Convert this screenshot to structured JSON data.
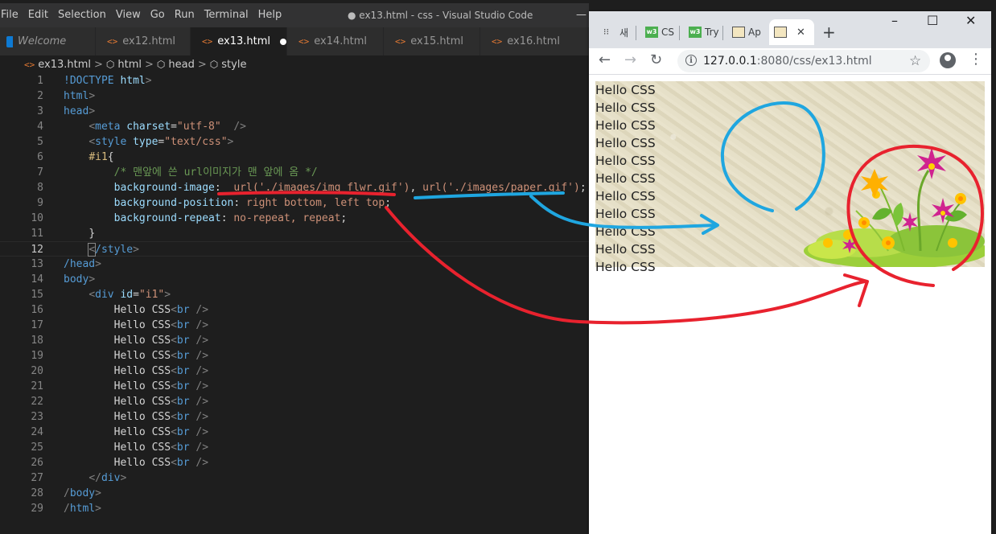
{
  "vscode": {
    "menu": [
      "File",
      "Edit",
      "Selection",
      "View",
      "Go",
      "Run",
      "Terminal",
      "Help"
    ],
    "window_title": "● ex13.html - css - Visual Studio Code",
    "tabs": [
      {
        "label": "Welcome",
        "active": false
      },
      {
        "label": "ex12.html",
        "active": false
      },
      {
        "label": "ex13.html",
        "active": true,
        "modified": true
      },
      {
        "label": "ex14.html",
        "active": false
      },
      {
        "label": "ex15.html",
        "active": false
      },
      {
        "label": "ex16.html",
        "active": false
      }
    ],
    "breadcrumb": [
      "ex13.html",
      "html",
      "head",
      "style"
    ],
    "code": [
      {
        "n": "1",
        "tokens": [
          [
            "tag",
            "!DOCTYPE "
          ],
          [
            "attr",
            "html"
          ],
          [
            "br",
            ">"
          ]
        ]
      },
      {
        "n": "2",
        "tokens": [
          [
            "tag",
            "html"
          ],
          [
            "br",
            ">"
          ]
        ]
      },
      {
        "n": "3",
        "tokens": [
          [
            "tag",
            "head"
          ],
          [
            "br",
            ">"
          ]
        ]
      },
      {
        "n": "4",
        "tokens": [
          [
            "txt",
            "    "
          ],
          [
            "br",
            "<"
          ],
          [
            "tag",
            "meta "
          ],
          [
            "attr",
            "charset"
          ],
          [
            "punc",
            "="
          ],
          [
            "str",
            "\"utf-8\""
          ],
          [
            "txt",
            "  "
          ],
          [
            "br",
            "/>"
          ]
        ]
      },
      {
        "n": "5",
        "tokens": [
          [
            "txt",
            "    "
          ],
          [
            "br",
            "<"
          ],
          [
            "tag",
            "style "
          ],
          [
            "attr",
            "type"
          ],
          [
            "punc",
            "="
          ],
          [
            "str",
            "\"text/css\""
          ],
          [
            "br",
            ">"
          ]
        ]
      },
      {
        "n": "6",
        "tokens": [
          [
            "txt",
            "    "
          ],
          [
            "sel",
            "#i1"
          ],
          [
            "punc",
            "{"
          ]
        ]
      },
      {
        "n": "7",
        "tokens": [
          [
            "txt",
            "        "
          ],
          [
            "com",
            "/* 맨앞에 쓴 url이미지가 맨 앞에 옴 */"
          ]
        ]
      },
      {
        "n": "8",
        "tokens": [
          [
            "txt",
            "        "
          ],
          [
            "prop",
            "background-image"
          ],
          [
            "punc",
            ":  "
          ],
          [
            "val",
            "url('./images/img_flwr.gif')"
          ],
          [
            "punc",
            ", "
          ],
          [
            "val",
            "url('./images/paper.gif')"
          ],
          [
            "punc",
            ";"
          ]
        ]
      },
      {
        "n": "9",
        "tokens": [
          [
            "txt",
            "        "
          ],
          [
            "prop",
            "background-position"
          ],
          [
            "punc",
            ": "
          ],
          [
            "val",
            "right bottom, left top"
          ],
          [
            "punc",
            ";"
          ]
        ]
      },
      {
        "n": "10",
        "tokens": [
          [
            "txt",
            "        "
          ],
          [
            "prop",
            "background-repeat"
          ],
          [
            "punc",
            ": "
          ],
          [
            "val",
            "no-repeat, repeat"
          ],
          [
            "punc",
            ";"
          ]
        ]
      },
      {
        "n": "11",
        "tokens": [
          [
            "txt",
            "    "
          ],
          [
            "punc",
            "}"
          ]
        ]
      },
      {
        "n": "12",
        "current": true,
        "tokens": [
          [
            "txt",
            "    "
          ],
          [
            "br",
            "<"
          ],
          [
            "tag",
            "/style"
          ],
          [
            "br",
            ">"
          ]
        ]
      },
      {
        "n": "13",
        "tokens": [
          [
            "tag",
            "/head"
          ],
          [
            "br",
            ">"
          ]
        ]
      },
      {
        "n": "14",
        "tokens": [
          [
            "tag",
            "body"
          ],
          [
            "br",
            ">"
          ]
        ]
      },
      {
        "n": "15",
        "tokens": [
          [
            "txt",
            "    "
          ],
          [
            "br",
            "<"
          ],
          [
            "tag",
            "div "
          ],
          [
            "attr",
            "id"
          ],
          [
            "punc",
            "="
          ],
          [
            "str",
            "\"i1\""
          ],
          [
            "br",
            ">"
          ]
        ]
      },
      {
        "n": "16",
        "tokens": [
          [
            "txt",
            "        Hello CSS"
          ],
          [
            "br",
            "<"
          ],
          [
            "tag",
            "br "
          ],
          [
            "br",
            "/>"
          ]
        ]
      },
      {
        "n": "17",
        "tokens": [
          [
            "txt",
            "        Hello CSS"
          ],
          [
            "br",
            "<"
          ],
          [
            "tag",
            "br "
          ],
          [
            "br",
            "/>"
          ]
        ]
      },
      {
        "n": "18",
        "tokens": [
          [
            "txt",
            "        Hello CSS"
          ],
          [
            "br",
            "<"
          ],
          [
            "tag",
            "br "
          ],
          [
            "br",
            "/>"
          ]
        ]
      },
      {
        "n": "19",
        "tokens": [
          [
            "txt",
            "        Hello CSS"
          ],
          [
            "br",
            "<"
          ],
          [
            "tag",
            "br "
          ],
          [
            "br",
            "/>"
          ]
        ]
      },
      {
        "n": "20",
        "tokens": [
          [
            "txt",
            "        Hello CSS"
          ],
          [
            "br",
            "<"
          ],
          [
            "tag",
            "br "
          ],
          [
            "br",
            "/>"
          ]
        ]
      },
      {
        "n": "21",
        "tokens": [
          [
            "txt",
            "        Hello CSS"
          ],
          [
            "br",
            "<"
          ],
          [
            "tag",
            "br "
          ],
          [
            "br",
            "/>"
          ]
        ]
      },
      {
        "n": "22",
        "tokens": [
          [
            "txt",
            "        Hello CSS"
          ],
          [
            "br",
            "<"
          ],
          [
            "tag",
            "br "
          ],
          [
            "br",
            "/>"
          ]
        ]
      },
      {
        "n": "23",
        "tokens": [
          [
            "txt",
            "        Hello CSS"
          ],
          [
            "br",
            "<"
          ],
          [
            "tag",
            "br "
          ],
          [
            "br",
            "/>"
          ]
        ]
      },
      {
        "n": "24",
        "tokens": [
          [
            "txt",
            "        Hello CSS"
          ],
          [
            "br",
            "<"
          ],
          [
            "tag",
            "br "
          ],
          [
            "br",
            "/>"
          ]
        ]
      },
      {
        "n": "25",
        "tokens": [
          [
            "txt",
            "        Hello CSS"
          ],
          [
            "br",
            "<"
          ],
          [
            "tag",
            "br "
          ],
          [
            "br",
            "/>"
          ]
        ]
      },
      {
        "n": "26",
        "tokens": [
          [
            "txt",
            "        Hello CSS"
          ],
          [
            "br",
            "<"
          ],
          [
            "tag",
            "br "
          ],
          [
            "br",
            "/>"
          ]
        ]
      },
      {
        "n": "27",
        "tokens": [
          [
            "txt",
            "    "
          ],
          [
            "br",
            "</"
          ],
          [
            "tag",
            "div"
          ],
          [
            "br",
            ">"
          ]
        ]
      },
      {
        "n": "28",
        "tokens": [
          [
            "br",
            "/"
          ],
          [
            "tag",
            "body"
          ],
          [
            "br",
            ">"
          ]
        ]
      },
      {
        "n": "29",
        "tokens": [
          [
            "br",
            "/"
          ],
          [
            "tag",
            "html"
          ],
          [
            "br",
            ">"
          ]
        ]
      }
    ]
  },
  "chrome": {
    "tabs": [
      {
        "label": "새",
        "favicon": "apps-grid-icon"
      },
      {
        "label": "CS",
        "favicon": "w3-icon"
      },
      {
        "label": "Try",
        "favicon": "w3-icon"
      },
      {
        "label": "Ap",
        "favicon": "image-icon"
      },
      {
        "label": "",
        "favicon": "image-icon",
        "active": true
      }
    ],
    "close_glyph": "✕",
    "new_tab_glyph": "+",
    "window_controls": [
      "–",
      "☐",
      "✕"
    ],
    "url_host": "127.0.0.1",
    "url_rest": ":8080/css/ex13.html",
    "page_lines": [
      "Hello CSS",
      "Hello CSS",
      "Hello CSS",
      "Hello CSS",
      "Hello CSS",
      "Hello CSS",
      "Hello CSS",
      "Hello CSS",
      "Hello CSS",
      "Hello CSS",
      "Hello CSS"
    ]
  },
  "colors": {
    "vscode_bg": "#1e1e1e",
    "annotation_red": "#e8222e",
    "annotation_blue": "#1fa6e0"
  }
}
